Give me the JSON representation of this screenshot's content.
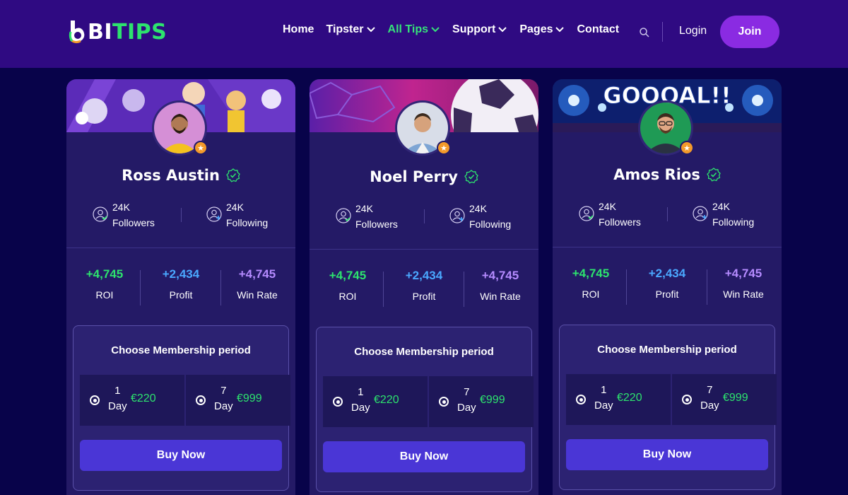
{
  "header": {
    "logo_bi": "BI",
    "logo_tips": "TIPS",
    "nav": [
      {
        "label": "Home",
        "dropdown": false,
        "active": false
      },
      {
        "label": "Tipster",
        "dropdown": true,
        "active": false
      },
      {
        "label": "All Tips",
        "dropdown": true,
        "active": true
      },
      {
        "label": "Support",
        "dropdown": true,
        "active": false
      },
      {
        "label": "Pages",
        "dropdown": true,
        "active": false
      },
      {
        "label": "Contact",
        "dropdown": false,
        "active": false
      }
    ],
    "login": "Login",
    "join": "Join"
  },
  "colors": {
    "background": "#08034a",
    "header": "#2f0a82",
    "card": "#241a66",
    "accent_green": "#2de36e",
    "accent_blue": "#4aa8ff",
    "accent_purple": "#b58bff",
    "button": "#4a36d6",
    "join": "#8a2be2"
  },
  "cards": [
    {
      "name": "Ross Austin",
      "banner": "sports-players-illustration",
      "followers_count": "24K",
      "followers_label": "Followers",
      "following_count": "24K",
      "following_label": "Following",
      "roi_value": "+4,745",
      "roi_label": "ROI",
      "profit_value": "+2,434",
      "profit_label": "Profit",
      "winrate_value": "+4,745",
      "winrate_label": "Win Rate",
      "membership_title": "Choose Membership period",
      "option1_num": "1",
      "option1_unit": "Day",
      "option1_price": "€220",
      "option2_num": "7",
      "option2_unit": "Day",
      "option2_price": "€999",
      "buy": "Buy Now"
    },
    {
      "name": "Noel Perry",
      "banner": "soccer-ball-illustration",
      "followers_count": "24K",
      "followers_label": "Followers",
      "following_count": "24K",
      "following_label": "Following",
      "roi_value": "+4,745",
      "roi_label": "ROI",
      "profit_value": "+2,434",
      "profit_label": "Profit",
      "winrate_value": "+4,745",
      "winrate_label": "Win Rate",
      "membership_title": "Choose Membership period",
      "option1_num": "1",
      "option1_unit": "Day",
      "option1_price": "€220",
      "option2_num": "7",
      "option2_unit": "Day",
      "option2_price": "€999",
      "buy": "Buy Now"
    },
    {
      "name": "Amos Rios",
      "banner": "stadium-lights",
      "banner_text": "GOOOAL!!",
      "followers_count": "24K",
      "followers_label": "Followers",
      "following_count": "24K",
      "following_label": "Following",
      "roi_value": "+4,745",
      "roi_label": "ROI",
      "profit_value": "+2,434",
      "profit_label": "Profit",
      "winrate_value": "+4,745",
      "winrate_label": "Win Rate",
      "membership_title": "Choose Membership period",
      "option1_num": "1",
      "option1_unit": "Day",
      "option1_price": "€220",
      "option2_num": "7",
      "option2_unit": "Day",
      "option2_price": "€999",
      "buy": "Buy Now"
    }
  ]
}
